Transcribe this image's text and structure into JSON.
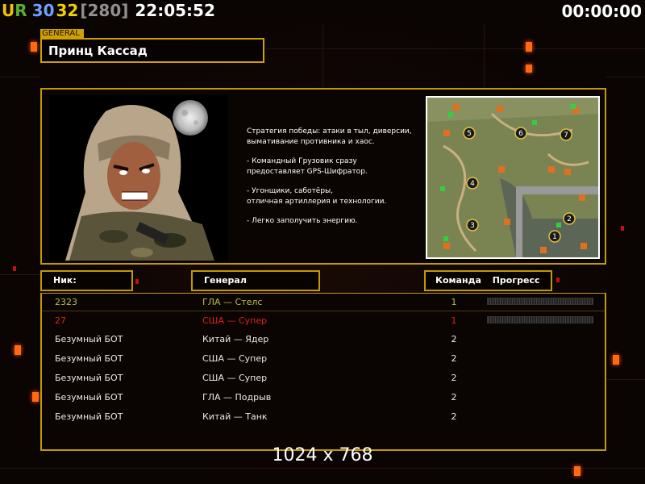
{
  "hud": {
    "u": "U",
    "r": "R",
    "num1": "30",
    "num2": "32",
    "bracket": "[280]",
    "clock": "22:05:52",
    "timer": "00:00:00"
  },
  "general": {
    "tag": "GENERAL",
    "name": "Принц Кассад"
  },
  "description": [
    "Стратегия победы: атаки в тыл, диверсии,\n вымативание противника и хаос.",
    "- Командный Грузовик сразу\nпредоставляет GPS-Шифратор.",
    "- Угонщики, саботёры,\nотличная артиллерия и технологии.",
    "- Легко заполучить энергию."
  ],
  "columns": {
    "nick": "Ник:",
    "general": "Генерал",
    "team": "Команда",
    "progress": "Прогресс"
  },
  "players": [
    {
      "nick": "2323",
      "general": "ГЛА — Стелс",
      "team": "1",
      "color": "#b8c040",
      "progress": 0
    },
    {
      "nick": "27",
      "general": "США — Супер",
      "team": "1",
      "color": "#e02020",
      "progress": 0
    },
    {
      "nick": "Безумный БОТ",
      "general": "Китай — Ядер",
      "team": "2",
      "color": "#e8e8e8"
    },
    {
      "nick": "Безумный БОТ",
      "general": "США — Супер",
      "team": "2",
      "color": "#e8e8e8"
    },
    {
      "nick": "Безумный БОТ",
      "general": "США — Супер",
      "team": "2",
      "color": "#e8e8e8"
    },
    {
      "nick": "Безумный БОТ",
      "general": "ГЛА — Подрыв",
      "team": "2",
      "color": "#e8e8e8"
    },
    {
      "nick": "Безумный БОТ",
      "general": "Китай — Танк",
      "team": "2",
      "color": "#e8e8e8"
    }
  ],
  "minimap": {
    "positions": [
      "1",
      "2",
      "3",
      "4",
      "5",
      "6",
      "7"
    ]
  },
  "resolution": "1024 x 768",
  "colors": {
    "accent": "#c09a00",
    "background": "#0d0604"
  }
}
